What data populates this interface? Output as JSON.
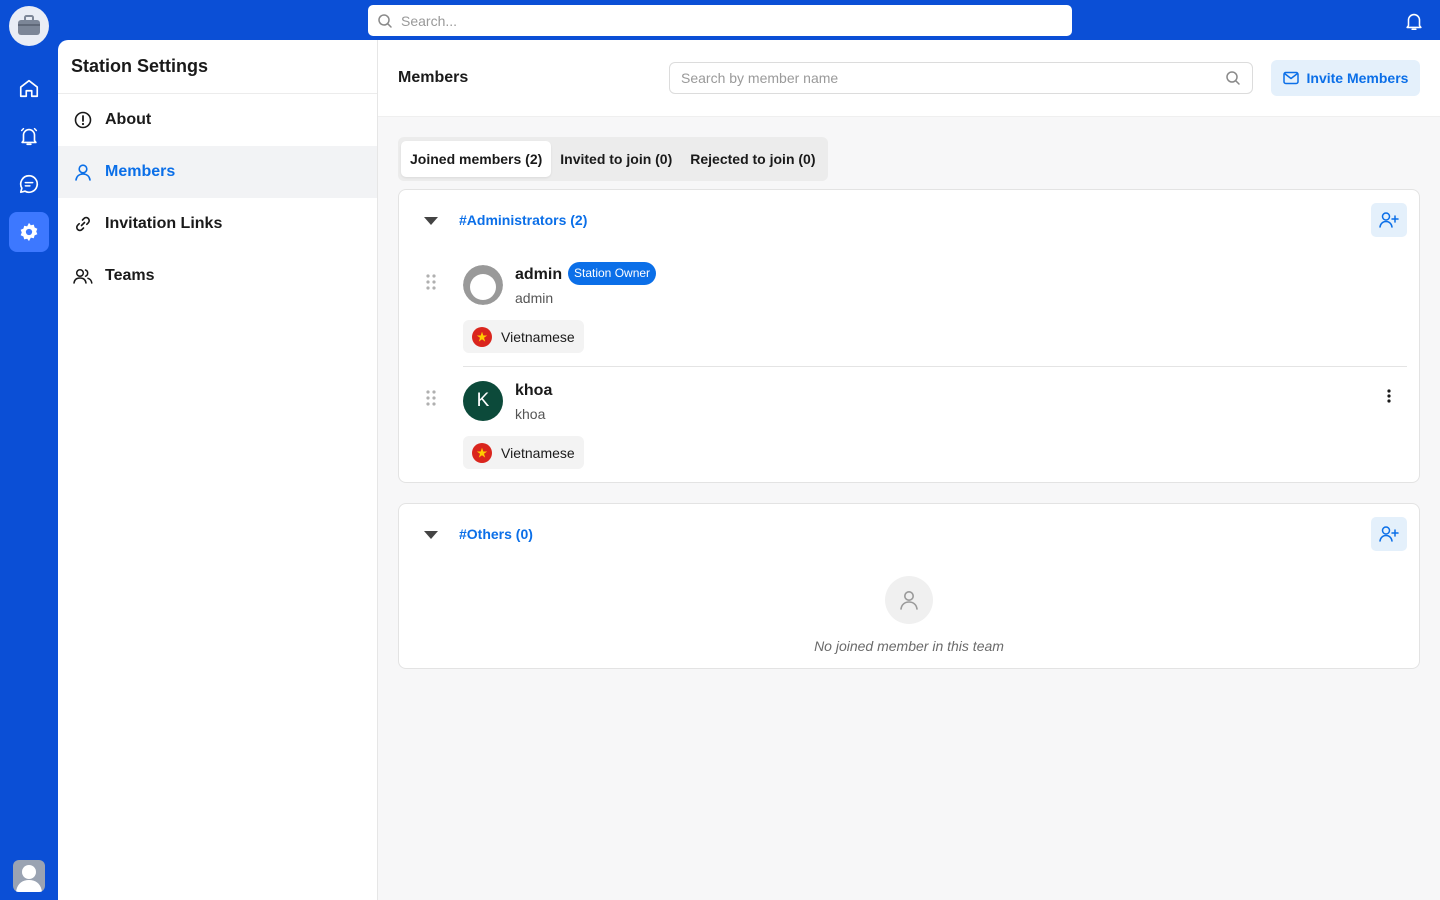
{
  "topbar": {
    "search_placeholder": "Search..."
  },
  "settings": {
    "title": "Station Settings",
    "items": [
      {
        "label": "About",
        "icon": "info-icon"
      },
      {
        "label": "Members",
        "icon": "user-icon",
        "active": true
      },
      {
        "label": "Invitation Links",
        "icon": "link-icon"
      },
      {
        "label": "Teams",
        "icon": "users-icon"
      }
    ]
  },
  "main": {
    "title": "Members",
    "search_placeholder": "Search by member name",
    "invite_label": "Invite Members",
    "tabs": [
      {
        "label": "Joined members (2)",
        "active": true
      },
      {
        "label": "Invited to join (0)"
      },
      {
        "label": "Rejected to join (0)"
      }
    ],
    "groups": [
      {
        "title": "#Administrators (2)",
        "members": [
          {
            "name": "admin",
            "username": "admin",
            "badge": "Station Owner",
            "language": "Vietnamese"
          },
          {
            "name": "khoa",
            "username": "khoa",
            "initial": "K",
            "language": "Vietnamese"
          }
        ]
      },
      {
        "title": "#Others (0)",
        "empty_text": "No joined member in this team"
      }
    ]
  },
  "colors": {
    "brand": "#0b4fd6",
    "accent": "#0b6fe8",
    "avatar_k": "#0c4a3a",
    "flag": "#da251d"
  }
}
